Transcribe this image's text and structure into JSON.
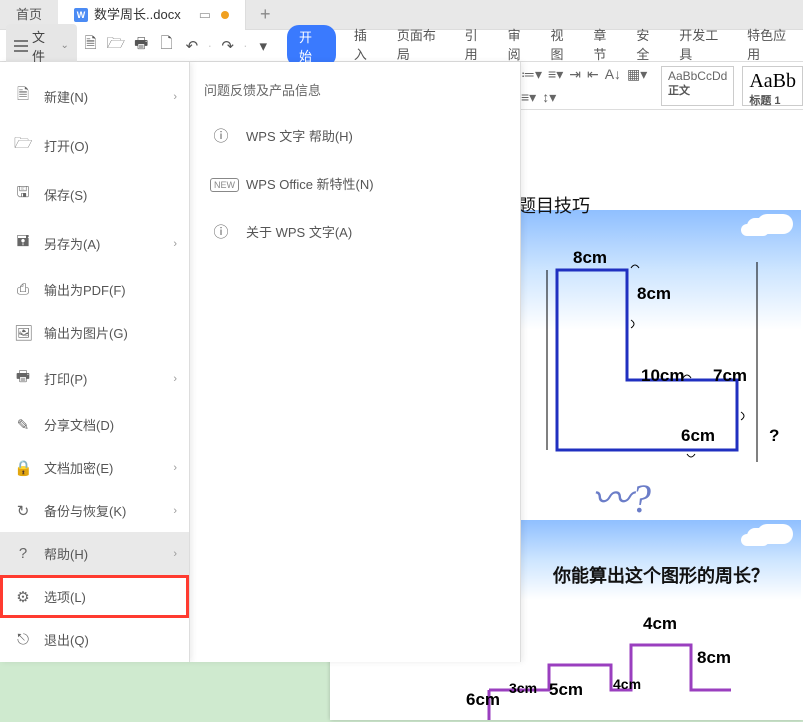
{
  "tabs": {
    "home": "首页",
    "doc_name": "数学周长..docx",
    "doc_letter": "W"
  },
  "toolbar": {
    "file_label": "文件"
  },
  "menus": {
    "start": "开始",
    "insert": "插入",
    "page_layout": "页面布局",
    "reference": "引用",
    "review": "审阅",
    "view": "视图",
    "chapter": "章节",
    "security": "安全",
    "dev_tools": "开发工具",
    "special": "特色应用"
  },
  "styles": {
    "normal_preview": "AaBbCcDd",
    "normal_label": "正文",
    "heading_preview": "AaBb",
    "heading_label": "标题 1"
  },
  "file_menu": {
    "new": "新建(N)",
    "open": "打开(O)",
    "save": "保存(S)",
    "save_as": "另存为(A)",
    "export_pdf": "输出为PDF(F)",
    "export_image": "输出为图片(G)",
    "print": "打印(P)",
    "share": "分享文档(D)",
    "encrypt": "文档加密(E)",
    "backup": "备份与恢复(K)",
    "help": "帮助(H)",
    "options": "选项(L)",
    "exit": "退出(Q)"
  },
  "help_panel": {
    "heading": "问题反馈及产品信息",
    "wps_help": "WPS 文字 帮助(H)",
    "wps_new": "WPS Office 新特性(N)",
    "about": "关于 WPS 文字(A)",
    "new_badge": "NEW"
  },
  "doc": {
    "partial_title": "题目技巧"
  },
  "fig1": {
    "a": "8cm",
    "b": "8cm",
    "c": "10cm",
    "d": "7cm",
    "e": "6cm",
    "q": "?"
  },
  "fig2": {
    "title": "你能算出这个图形的周长？",
    "a": "4cm",
    "b": "8cm",
    "c": "3cm",
    "d": "5cm",
    "e": "4cm",
    "f": "6cm"
  }
}
